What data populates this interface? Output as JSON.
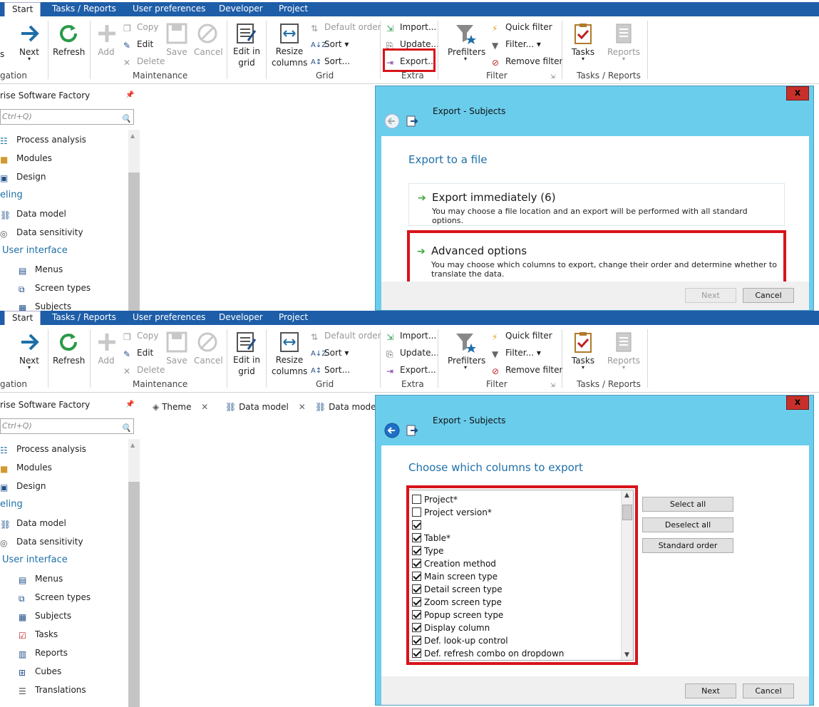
{
  "tabs": [
    "Start",
    "Tasks / Reports",
    "User preferences",
    "Developer",
    "Project"
  ],
  "ribbon": {
    "next": "Next",
    "refresh": "Refresh",
    "add": "Add",
    "copy": "Copy",
    "edit": "Edit",
    "delete": "Delete",
    "save": "Save",
    "cancel": "Cancel",
    "edit_grid_1": "Edit in",
    "edit_grid_2": "grid",
    "resize_1": "Resize",
    "resize_2": "columns",
    "default_order": "Default order",
    "sort": "Sort",
    "sort_dots": "Sort...",
    "import": "Import...",
    "update": "Update...",
    "export": "Export...",
    "prefilters": "Prefilters",
    "quick_filter": "Quick filter",
    "filter": "Filter...",
    "remove_filter": "Remove filter",
    "tasks": "Tasks",
    "reports": "Reports",
    "groups": {
      "navigation": "gation",
      "maintenance": "Maintenance",
      "grid": "Grid",
      "extra": "Extra",
      "filter": "Filter",
      "tasks_reports": "Tasks / Reports"
    }
  },
  "sidebar": {
    "title": "rise Software Factory",
    "search_placeholder": "Ctrl+Q)",
    "items": [
      "Process analysis",
      "Modules",
      "Design"
    ],
    "section_modeling": "eling",
    "modeling_items": [
      "Data model",
      "Data sensitivity"
    ],
    "section_ui": "User interface",
    "ui_items": [
      "Menus",
      "Screen types",
      "Subjects",
      "Tasks",
      "Reports",
      "Cubes",
      "Translations"
    ]
  },
  "doc_tabs": [
    "Theme",
    "Data model",
    "Data model"
  ],
  "dialog1": {
    "close": "x",
    "title": "Export - Subjects",
    "heading": "Export to a file",
    "opt1_title": "Export immediately (6)",
    "opt1_desc": "You may choose a file location and an export will be performed with all standard options.",
    "opt2_title": "Advanced options",
    "opt2_desc_1": "You may choose which columns to export, change their order and determine whether to",
    "opt2_desc_2": "translate the data.",
    "next": "Next",
    "cancel": "Cancel"
  },
  "dialog2": {
    "close": "x",
    "title": "Export - Subjects",
    "heading": "Choose which columns to export",
    "columns": [
      {
        "label": "Project*",
        "checked": false
      },
      {
        "label": "Project version*",
        "checked": false
      },
      {
        "label": "",
        "checked": true
      },
      {
        "label": "Table*",
        "checked": true
      },
      {
        "label": "Type",
        "checked": true
      },
      {
        "label": "Creation method",
        "checked": true
      },
      {
        "label": "Main screen type",
        "checked": true
      },
      {
        "label": "Detail screen type",
        "checked": true
      },
      {
        "label": "Zoom screen type",
        "checked": true
      },
      {
        "label": "Popup screen type",
        "checked": true
      },
      {
        "label": "Display column",
        "checked": true
      },
      {
        "label": "Def. look-up control",
        "checked": true
      },
      {
        "label": "Def. refresh combo on dropdown",
        "checked": true
      }
    ],
    "select_all": "Select all",
    "deselect_all": "Deselect all",
    "standard_order": "Standard order",
    "next": "Next",
    "cancel": "Cancel"
  },
  "colors": {
    "tabbar": "#1e5ea8",
    "dialog_frame": "#6acdec",
    "highlight": "#d8131a",
    "accent_text": "#1e6fa8"
  }
}
